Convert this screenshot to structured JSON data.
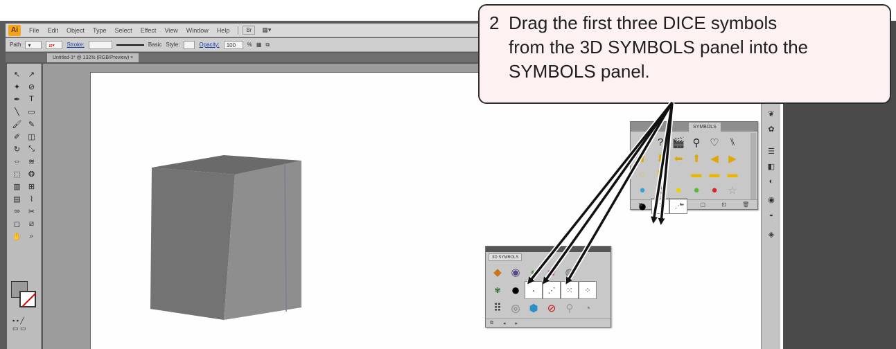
{
  "app": {
    "logo_text": "Ai"
  },
  "menu": {
    "items": [
      "File",
      "Edit",
      "Object",
      "Type",
      "Select",
      "Effect",
      "View",
      "Window",
      "Help"
    ],
    "badge": "Br"
  },
  "control_bar": {
    "path_label": "Path",
    "stroke_label": "Stroke:",
    "brush_label": "Basic",
    "style_label": "Style:",
    "opacity_label": "Opacity:",
    "opacity_value": "100",
    "opacity_unit": "%"
  },
  "document_tab": {
    "title": "Untitled-1* @ 132% (RGB/Preview)",
    "close": "×"
  },
  "tools_icons": [
    "selection-icon",
    "direct-selection-icon",
    "magic-wand-icon",
    "lasso-icon",
    "pen-icon",
    "type-icon",
    "line-icon",
    "rectangle-icon",
    "paintbrush-icon",
    "pencil-icon",
    "blob-brush-icon",
    "eraser-icon",
    "rotate-icon",
    "scale-icon",
    "width-icon",
    "warp-icon",
    "free-transform-icon",
    "symbol-sprayer-icon",
    "graph-icon",
    "mesh-icon",
    "gradient-icon",
    "eyedropper-icon",
    "blend-icon",
    "scissors-icon",
    "artboard-icon",
    "slice-icon",
    "hand-icon",
    "zoom-icon"
  ],
  "symbols_panel": {
    "tab_label": "SYMBOLS",
    "footer_icons": [
      "library-icon",
      "place-icon",
      "break-link-icon",
      "options-icon",
      "new-symbol-icon",
      "delete-icon"
    ]
  },
  "sym3d_panel": {
    "tab_label": "3D SYMBOLS"
  },
  "callout": {
    "number": "2",
    "text": "Drag the first three DICE symbols\nfrom the 3D SYMBOLS panel into the\nSYMBOLS panel."
  },
  "colors": {
    "callout_bg": "#fdf2f1",
    "fill": "#9a9a9a",
    "stroke_none": "#dd0000"
  }
}
